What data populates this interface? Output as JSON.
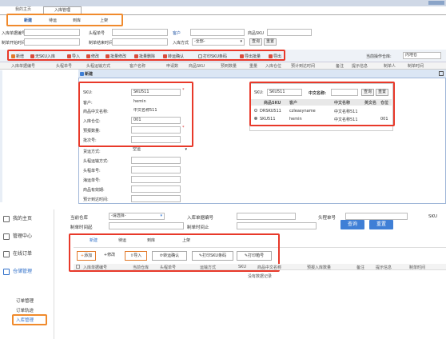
{
  "top": {
    "tabs": [
      "我的主页",
      "入库管理"
    ],
    "subtabs": [
      "新建",
      "待运",
      "到库",
      "上架"
    ],
    "filters": {
      "entry_no_label": "入库单据编号",
      "sku_label": "头程单号",
      "customer_label": "客户",
      "product_sku_label": "商品SKU",
      "create_time_label": "制单开始时间",
      "end_time_label": "制单结束时间",
      "entry_method_label": "入库方式",
      "entry_method_value": "-全部-",
      "query_label": "查询",
      "reset_label": "重置"
    },
    "toolbar": [
      "新增",
      "无SKU入库",
      "导入",
      "修改",
      "批量修改",
      "批量删除",
      "转运确认",
      "打印SKU条码",
      "导出批量",
      "导出"
    ],
    "toolbar_right": {
      "label": "当前操作仓库:",
      "value": "内地仓"
    },
    "columns": [
      "入库单据编号",
      "头程单号",
      "头程运输方式",
      "客户名称",
      "申请数",
      "商品SKU",
      "预到数量",
      "重量",
      "入库仓位",
      "预计到达时间",
      "备注",
      "提示信息",
      "制单人",
      "制单时间"
    ],
    "dialog": {
      "title": "新建",
      "sku_label": "SKU:",
      "sku_value": "SKU511",
      "customer_label": "客户:",
      "customer_value": "hemin",
      "cn_name_label": "商品中文名称:",
      "cn_name_value": "中文名称511",
      "position_label": "入库仓位:",
      "position_value": "001",
      "expected_qty_label": "预报数量:",
      "batch_label": "批次号:",
      "ship_method_label": "货运方式:",
      "ship_method_value": "空运",
      "leg_method_label": "头程运输方式:",
      "leg_no_label": "头程单号:",
      "transfer_no_label": "海运单号:",
      "valid_date_label": "商品有效期:",
      "arrival_label": "预计到达时间:"
    },
    "search_panel": {
      "sku_label": "SKU:",
      "sku_value": "SKU511",
      "cn_name_label": "中文名称:",
      "query_label": "查询",
      "reset_label": "重置",
      "headers": [
        "商品SKU",
        "客户",
        "中文名称",
        "英文名",
        "仓位"
      ],
      "rows": [
        [
          "DRSKU511",
          "czleasyname",
          "中文名称511",
          "",
          ""
        ],
        [
          "SKU511",
          "hemin",
          "中文名称511",
          "",
          "001"
        ]
      ]
    }
  },
  "bottom": {
    "sidebar": [
      {
        "label": "我的主页",
        "icon": "home-icon"
      },
      {
        "label": "管理中心",
        "icon": "grid-icon"
      },
      {
        "label": "在线订单",
        "icon": "order-icon"
      },
      {
        "label": "仓储管理",
        "icon": "warehouse-icon"
      }
    ],
    "sidebar_sub": [
      "订单管理",
      "订单轨迹",
      "入库管理"
    ],
    "filters": {
      "warehouse_label": "当前仓库",
      "warehouse_placeholder": "-请选择-",
      "entry_no_label": "入库单据编号",
      "leg_no_label": "头程单号",
      "sku_label": "SKU",
      "create_time_label": "制单时间起",
      "end_time_label": "制单时间止",
      "query_label": "查询",
      "reset_label": "重置"
    },
    "tabs": [
      "新建",
      "待运",
      "到库",
      "上架"
    ],
    "toolbar": [
      "添加",
      "修改",
      "导入",
      "转运确认",
      "打印SKU条码",
      "打印箱号"
    ],
    "columns": [
      "入库单据编号",
      "当前仓库",
      "头程单号",
      "运输方式",
      "SKU",
      "商品中文名称",
      "预报入库数量",
      "备注",
      "提示信息",
      "制单时间"
    ],
    "empty_text": "没有数据记录"
  }
}
